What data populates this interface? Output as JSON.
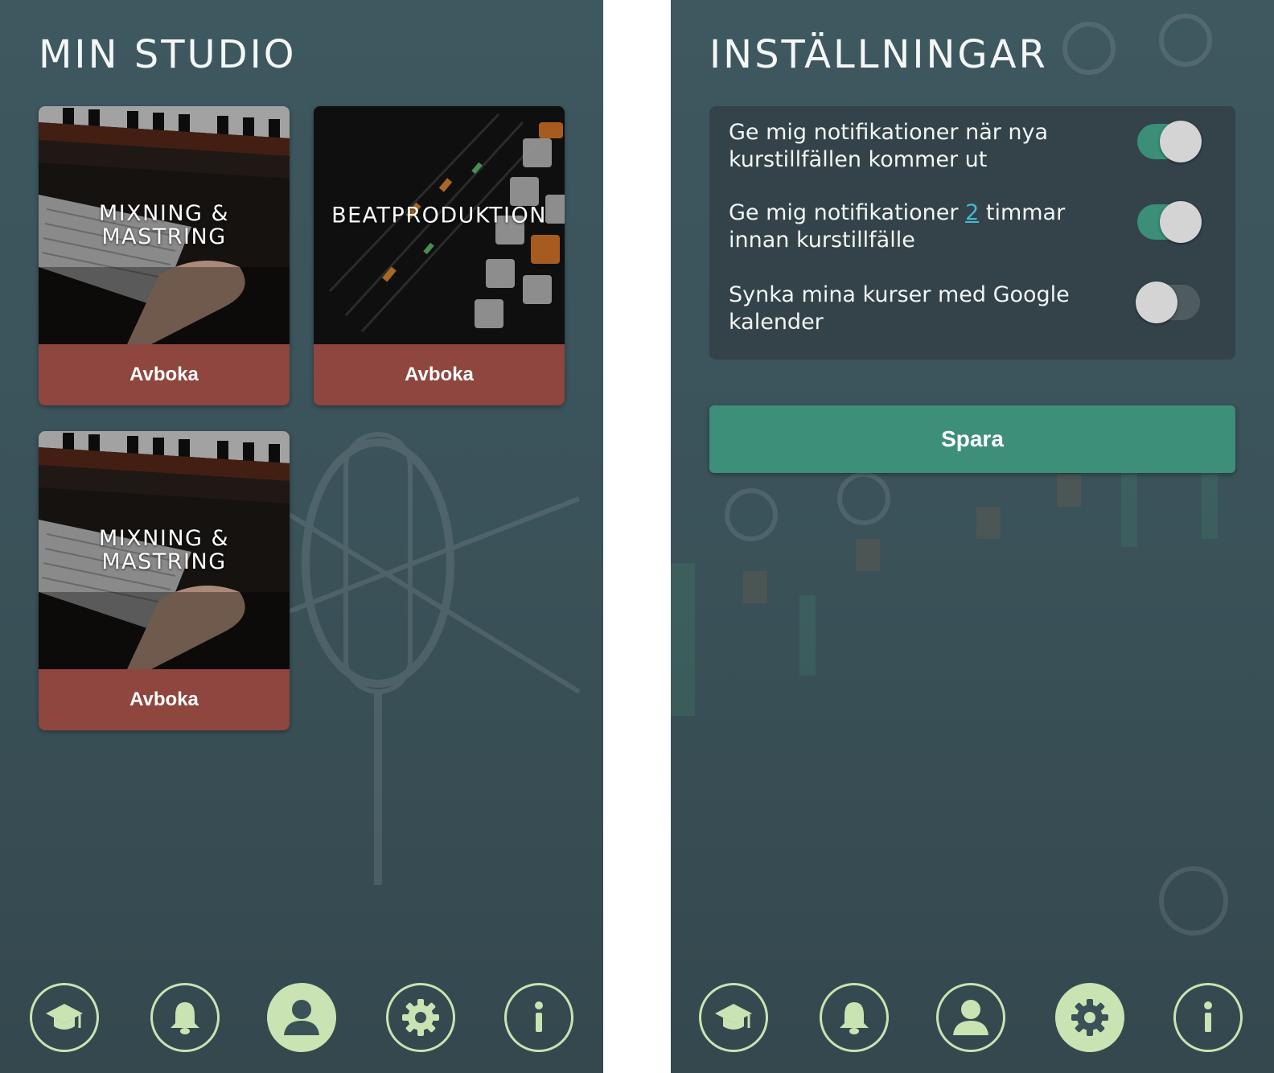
{
  "studio": {
    "title": "MIN STUDIO",
    "cards": [
      {
        "title": "MIXNING & MASTRING",
        "button": "Avboka"
      },
      {
        "title": "BEATPRODUKTION",
        "button": "Avboka"
      },
      {
        "title": "MIXNING & MASTRING",
        "button": "Avboka"
      }
    ],
    "active_nav": "profile"
  },
  "settings": {
    "title": "INSTÄLLNINGAR",
    "options": [
      {
        "text": "Ge mig notifikationer när nya kurstillfällen kommer ut",
        "enabled": true
      },
      {
        "text_before": "Ge mig notifikationer ",
        "hours": "2",
        "text_after": " timmar innan kurstillfälle",
        "enabled": true
      },
      {
        "text": "Synka mina kurser med Google kalender",
        "enabled": false
      }
    ],
    "save_label": "Spara",
    "active_nav": "settings"
  },
  "nav_icons": [
    "graduation-cap-icon",
    "bell-icon",
    "user-icon",
    "gear-icon",
    "info-icon"
  ],
  "colors": {
    "background": "#3a5158",
    "accent_green": "#3d8f7a",
    "cancel_red": "#8e463e",
    "nav_light_green": "#c9e3b3",
    "highlight_blue": "#46b8d4"
  }
}
